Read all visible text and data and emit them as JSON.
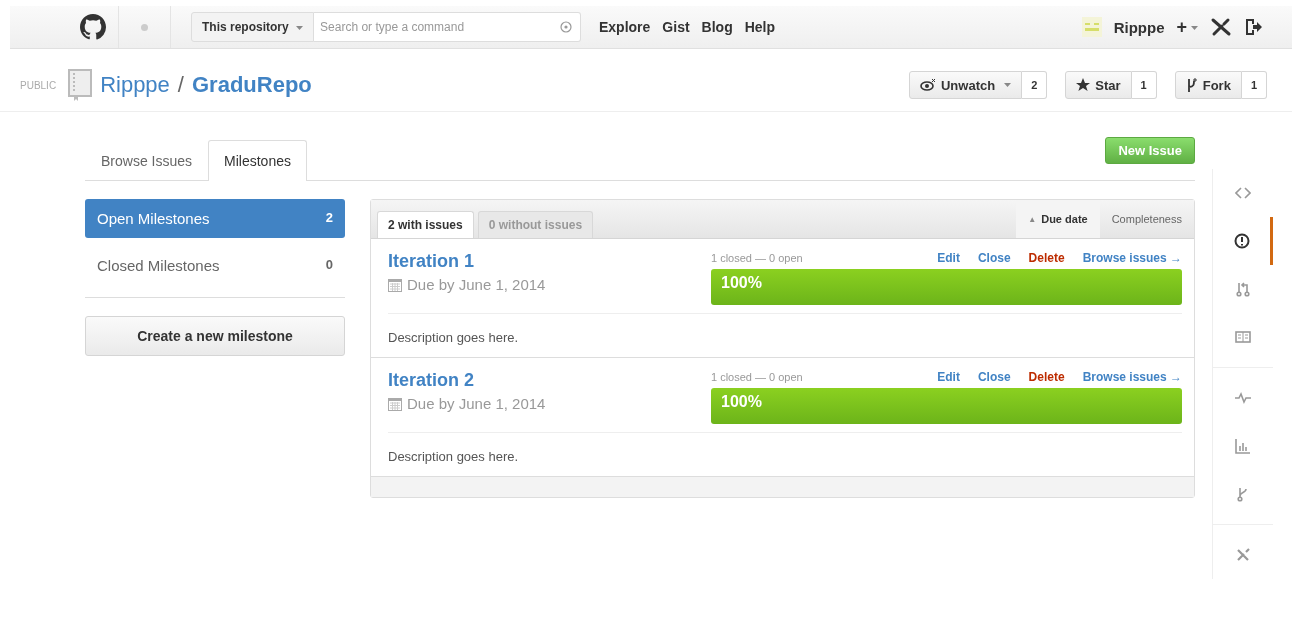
{
  "header": {
    "scope": "This repository",
    "search": {
      "placeholder": "Search or type a command"
    },
    "nav": [
      "Explore",
      "Gist",
      "Blog",
      "Help"
    ],
    "user": "Ripppe",
    "add": "+"
  },
  "repo": {
    "visibility": "PUBLIC",
    "owner": "Ripppe",
    "separator": "/",
    "name": "GraduRepo",
    "actions": [
      {
        "kind": "watch",
        "label": "Unwatch",
        "count": "2"
      },
      {
        "kind": "star",
        "label": "Star",
        "count": "1"
      },
      {
        "kind": "fork",
        "label": "Fork",
        "count": "1"
      }
    ]
  },
  "tabs": [
    {
      "label": "Browse Issues",
      "selected": false
    },
    {
      "label": "Milestones",
      "selected": true
    }
  ],
  "new_issue": "New Issue",
  "sidebar": {
    "items": [
      {
        "label": "Open Milestones",
        "count": "2",
        "selected": true
      },
      {
        "label": "Closed Milestones",
        "count": "0",
        "selected": false
      }
    ],
    "create": "Create a new milestone"
  },
  "filters": [
    {
      "label": "2 with issues",
      "selected": true
    },
    {
      "label": "0 without issues",
      "selected": false
    }
  ],
  "sort": [
    {
      "label": "Due date",
      "arrow": "▲",
      "selected": true
    },
    {
      "label": "Completeness",
      "selected": false
    }
  ],
  "milestones": [
    {
      "title": "Iteration 1",
      "due": "Due by June 1, 2014",
      "stats": "1 closed — 0 open",
      "actions": [
        {
          "kind": "link",
          "label": "Edit"
        },
        {
          "kind": "link",
          "label": "Close"
        },
        {
          "kind": "danger",
          "label": "Delete"
        },
        {
          "kind": "link",
          "label": "Browse issues →"
        }
      ],
      "level": 1,
      "percent": "100%",
      "description": "Description goes here."
    },
    {
      "title": "Iteration 2",
      "due": "Due by June 1, 2014",
      "stats": "1 closed — 0 open",
      "actions": [
        {
          "kind": "link",
          "label": "Edit"
        },
        {
          "kind": "link",
          "label": "Close"
        },
        {
          "kind": "danger",
          "label": "Delete"
        },
        {
          "kind": "link",
          "label": "Browse issues →"
        }
      ],
      "level": 1,
      "percent": "100%",
      "description": "Description goes here."
    }
  ],
  "repo_nav": [
    {
      "selected": false
    },
    {
      "selected": true
    },
    {
      "selected": false
    },
    {
      "selected": false
    },
    {
      "selected": false
    },
    {
      "selected": false
    },
    {
      "selected": false
    },
    {
      "selected": false
    }
  ]
}
